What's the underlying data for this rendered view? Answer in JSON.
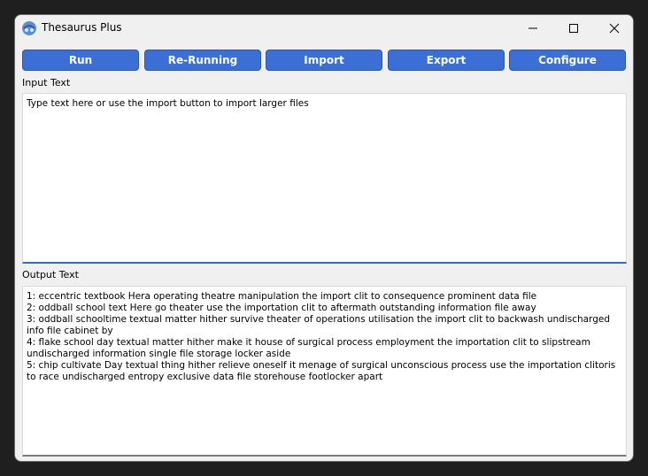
{
  "window": {
    "title": "Thesaurus Plus"
  },
  "icons": {
    "app": "app-icon",
    "minimize": "minimize-icon",
    "maximize": "maximize-icon",
    "close": "close-icon"
  },
  "toolbar": {
    "run_label": "Run",
    "rerunning_label": "Re-Running",
    "import_label": "Import",
    "export_label": "Export",
    "configure_label": "Configure"
  },
  "input": {
    "label": "Input Text",
    "value": "Type text here or use the import button to import larger files"
  },
  "output": {
    "label": "Output Text",
    "lines": [
      "1: eccentric textbook Hera operating theatre manipulation the import clit to consequence prominent data file",
      "2: oddball school text Here go theater use the importation clit to aftermath outstanding information file away",
      "3: oddball schooltime textual matter hither survive theater of operations utilisation the import clit to backwash undischarged info file cabinet by",
      "4: flake school day textual matter hither make it house of surgical process employment the importation clit to slipstream undischarged information single file storage locker aside",
      "5: chip cultivate Day textual thing hither relieve oneself it menage of surgical unconscious process use the importation clitoris to race undischarged entropy exclusive data file storehouse footlocker apart"
    ]
  },
  "colors": {
    "button_bg": "#3c6fd5",
    "button_text": "#ffffff",
    "input_focus_border": "#2f6bd6",
    "window_bg": "#f0f0f0"
  }
}
